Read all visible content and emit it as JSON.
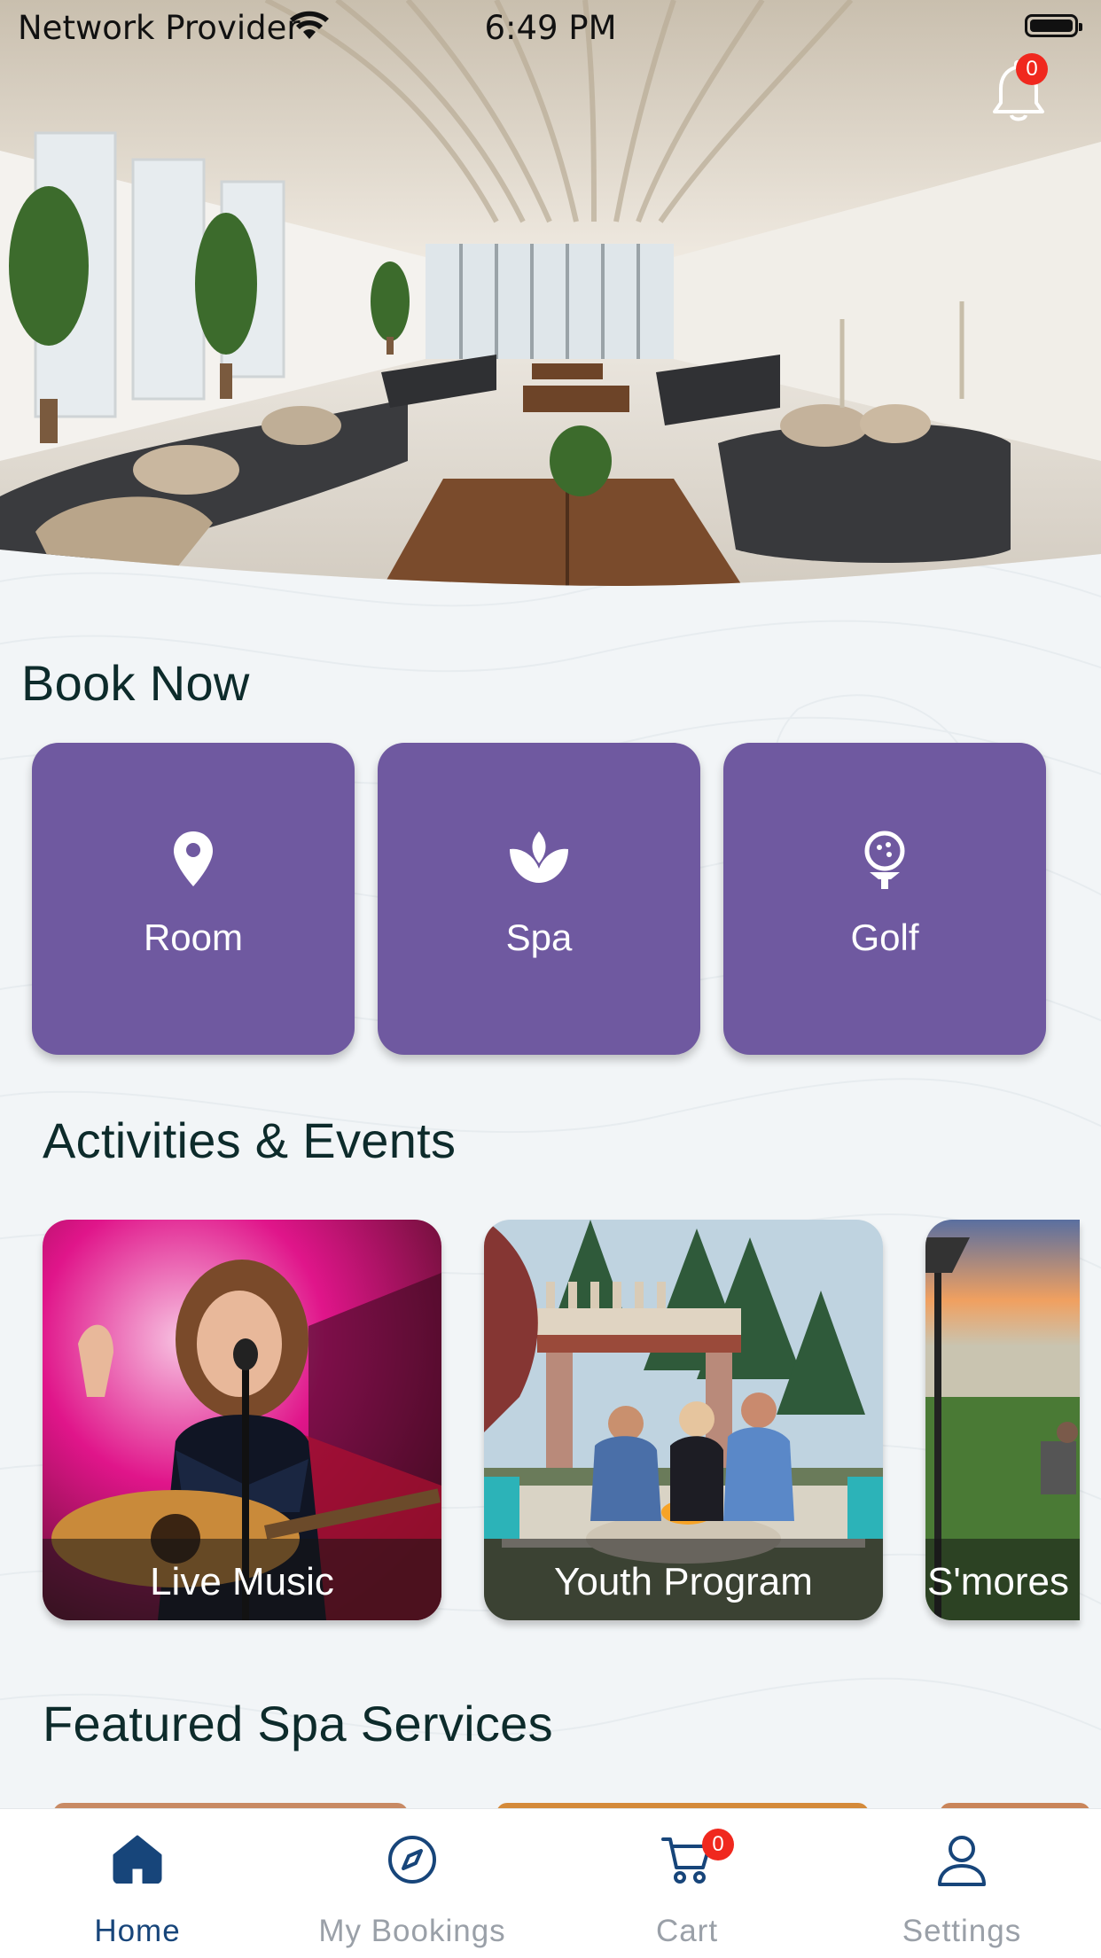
{
  "status_bar": {
    "carrier": "Network Provider",
    "time": "6:49 PM"
  },
  "notifications": {
    "count": "0"
  },
  "book_now": {
    "title": "Book Now",
    "items": [
      {
        "label": "Room",
        "icon": "location-pin-icon"
      },
      {
        "label": "Spa",
        "icon": "lotus-icon"
      },
      {
        "label": "Golf",
        "icon": "golf-ball-tee-icon"
      }
    ]
  },
  "activities": {
    "title": "Activities & Events",
    "items": [
      {
        "label": "Live Music"
      },
      {
        "label": "Youth Program"
      },
      {
        "label": "S'mores"
      }
    ]
  },
  "featured_spa": {
    "title": "Featured Spa Services"
  },
  "tabbar": {
    "items": [
      {
        "label": "Home",
        "icon": "home-icon",
        "active": true
      },
      {
        "label": "My Bookings",
        "icon": "compass-icon",
        "active": false
      },
      {
        "label": "Cart",
        "icon": "cart-icon",
        "active": false,
        "badge": "0"
      },
      {
        "label": "Settings",
        "icon": "person-icon",
        "active": false
      }
    ]
  },
  "colors": {
    "accent_purple": "#6f59a0",
    "active_tab": "#17457a",
    "inactive_tab": "#9aa0a8",
    "badge_red": "#f0281e",
    "background": "#f2f5f7"
  }
}
